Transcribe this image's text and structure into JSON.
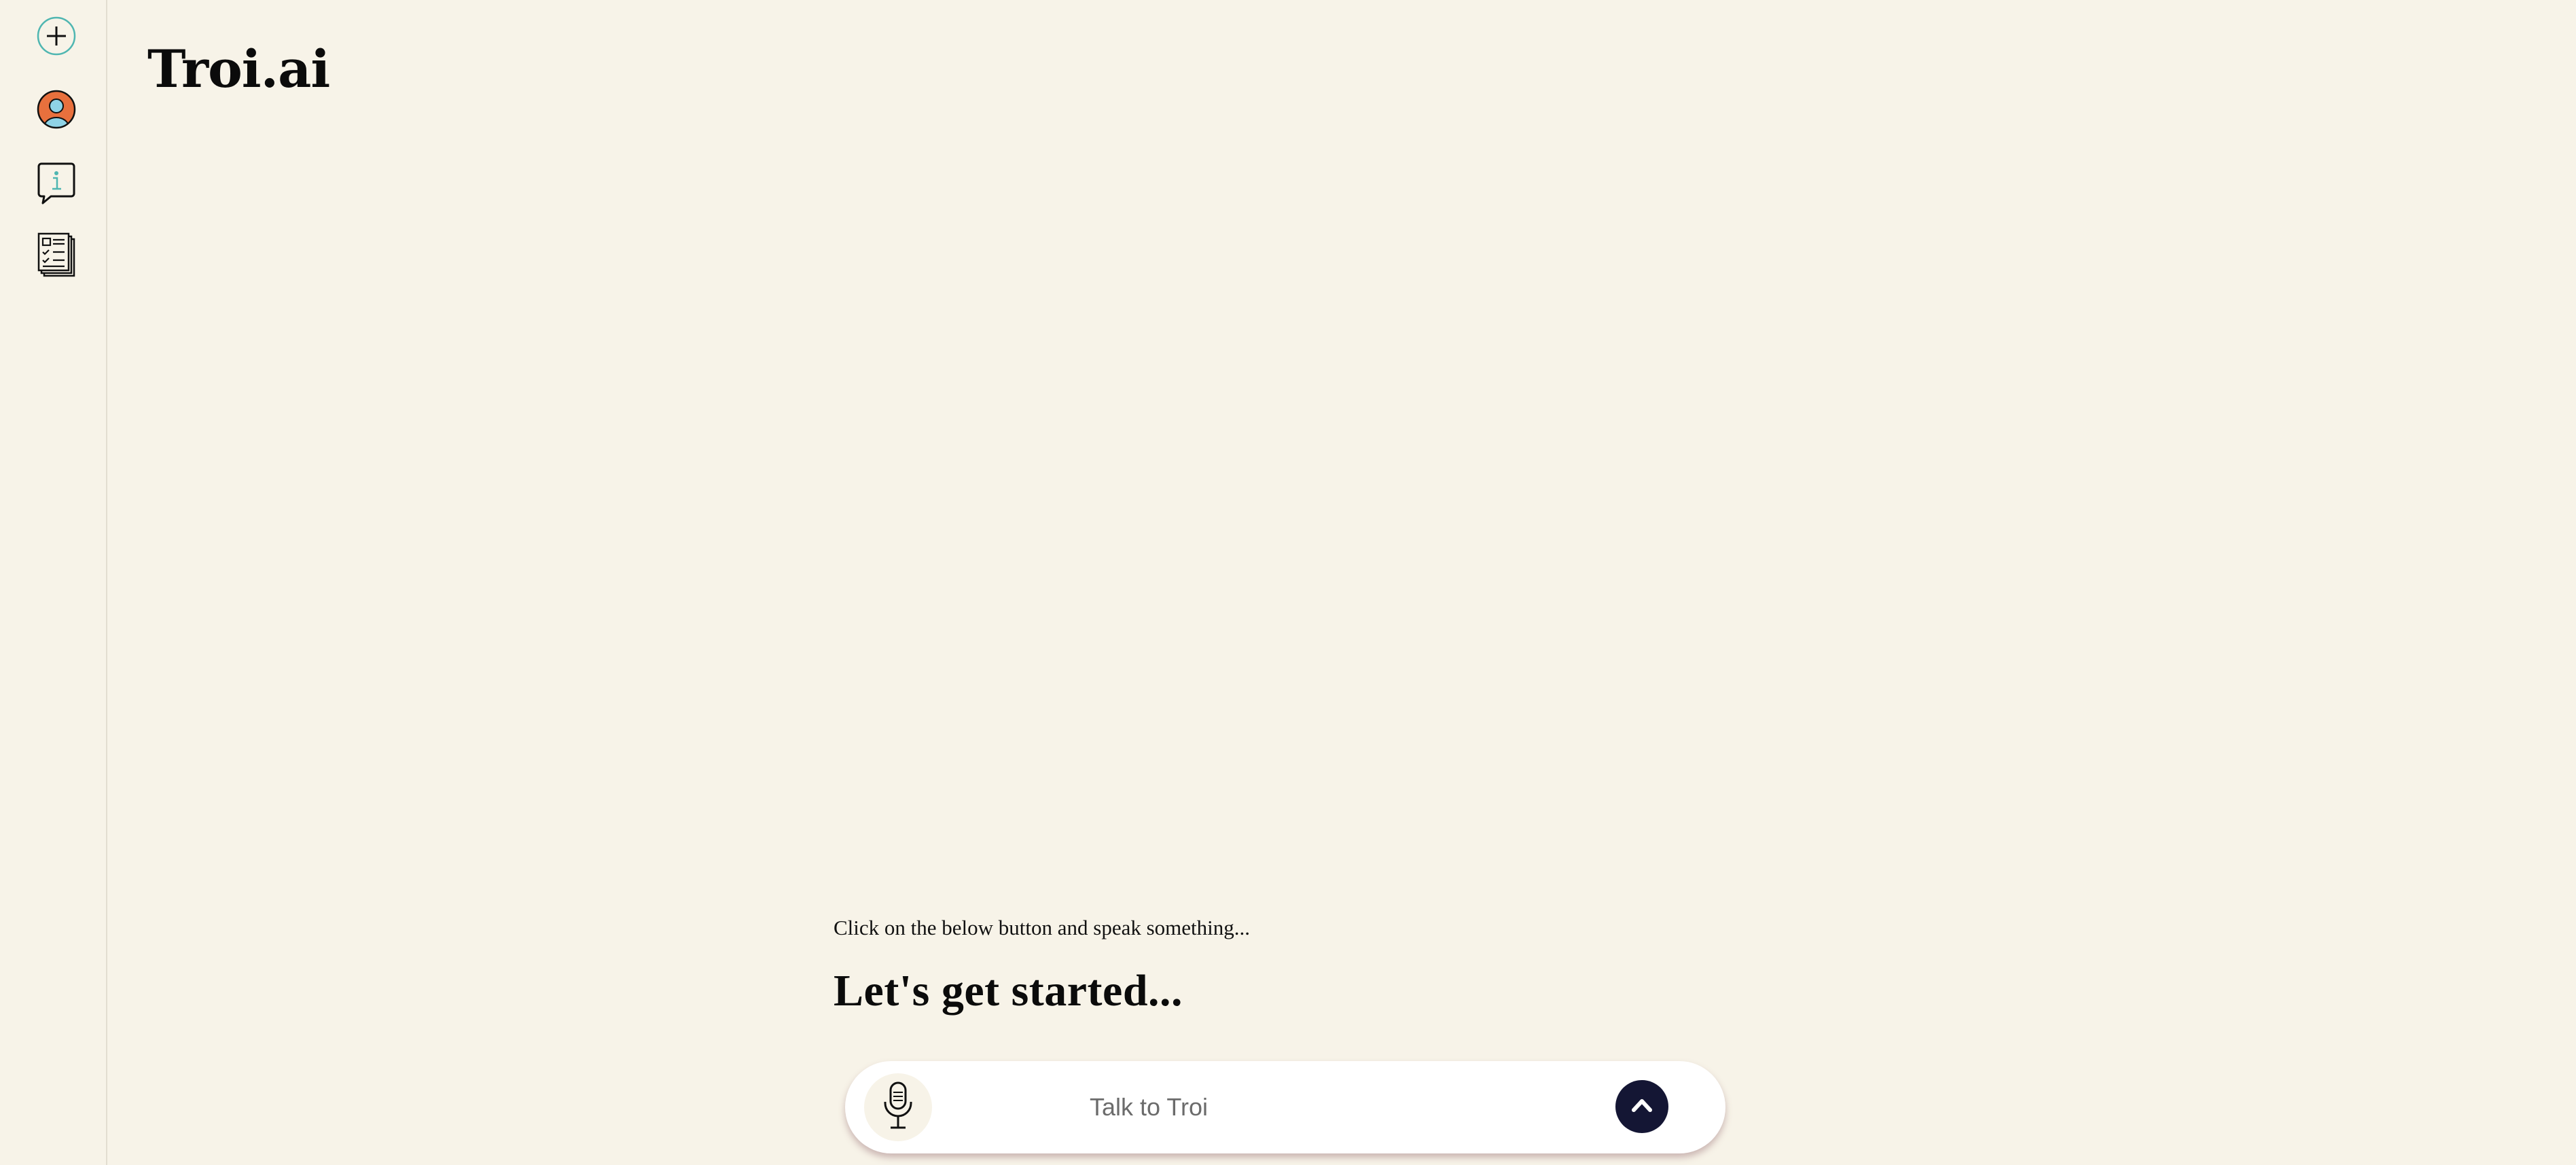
{
  "brand": {
    "name": "Troi.ai"
  },
  "sidebar": {
    "items": [
      {
        "icon": "plus-circle-icon"
      },
      {
        "icon": "user-avatar-icon"
      },
      {
        "icon": "info-chat-icon"
      },
      {
        "icon": "document-list-icon"
      }
    ]
  },
  "main": {
    "hint": "Click on the below button and speak something...",
    "headline": "Let's get started..."
  },
  "input": {
    "placeholder": "Talk to Troi",
    "value": ""
  },
  "colors": {
    "background": "#f7f3e8",
    "send_button": "#141634",
    "accent_teal": "#4fb6b1",
    "avatar_orange": "#e8703d",
    "avatar_blue": "#8fd3e6"
  }
}
